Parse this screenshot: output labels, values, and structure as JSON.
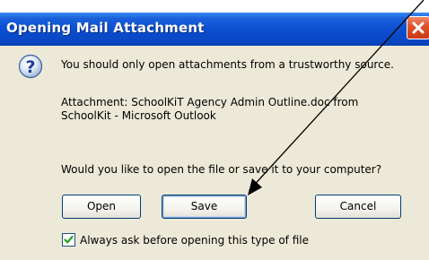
{
  "window": {
    "title": "Opening Mail Attachment"
  },
  "message": {
    "warning": "You should only open attachments from a trustworthy source.",
    "attachment_line1": "Attachment: SchoolKiT Agency Admin Outline.doc from",
    "attachment_line2": "SchoolKit - Microsoft Outlook",
    "question": "Would you like to open the file or save it to your computer?"
  },
  "buttons": {
    "open": "Open",
    "save": "Save",
    "cancel": "Cancel"
  },
  "checkbox": {
    "label": "Always ask before opening this type of file",
    "checked": true
  },
  "icons": {
    "info": "question-icon",
    "close": "close-icon"
  },
  "colors": {
    "titlebar": "#0b4fd1",
    "close_button": "#e0542e",
    "dialog_background": "#ece9d8",
    "button_border": "#003c74"
  }
}
